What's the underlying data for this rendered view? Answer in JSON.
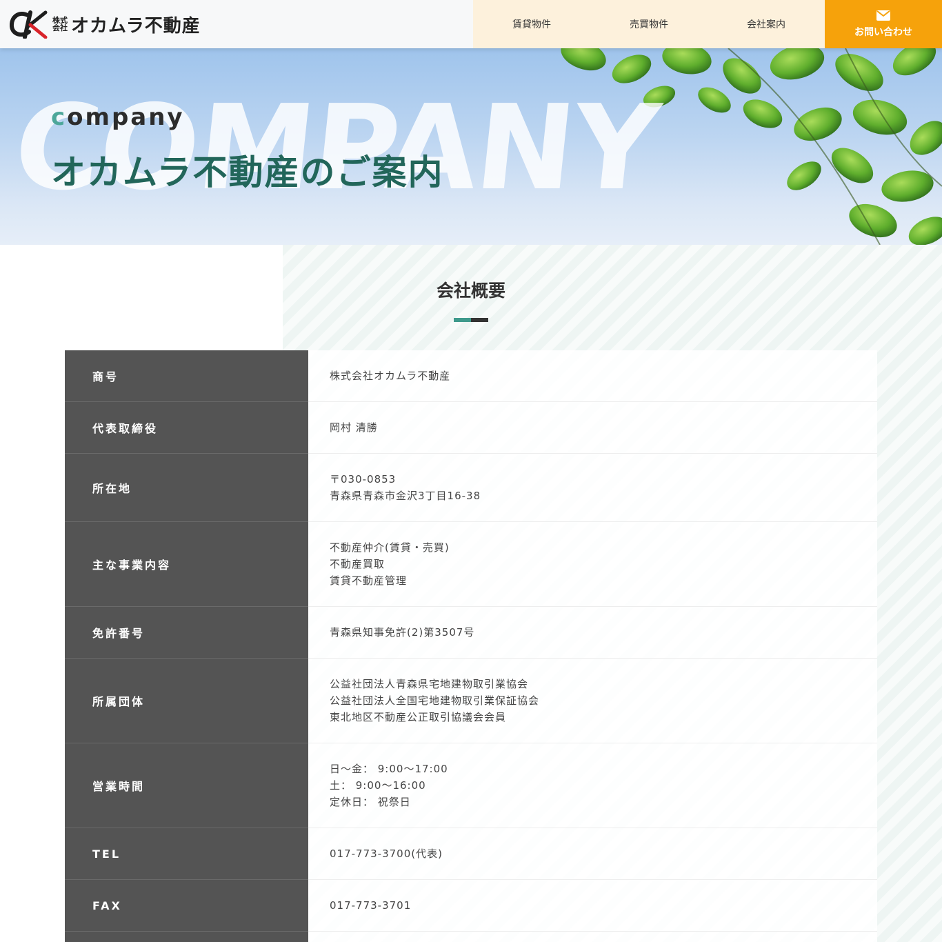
{
  "header": {
    "logo_kabu": [
      "株式",
      "会社"
    ],
    "logo_name": "オカムラ不動産",
    "nav": [
      "賃貸物件",
      "売買物件",
      "会社案内"
    ],
    "contact_label": "お問い合わせ"
  },
  "hero": {
    "watermark": "COMPANY",
    "sub_first": "c",
    "sub_rest": "ompany",
    "title": "オカムラ不動産のご案内"
  },
  "section": {
    "title": "会社概要"
  },
  "colors": {
    "accent": "#f6a20b",
    "brand_green": "#22665a",
    "nav_bg": "#fdf1dc",
    "table_head": "#545454"
  },
  "company_table": [
    {
      "label": "商号",
      "lines": [
        "株式会社オカムラ不動産"
      ]
    },
    {
      "label": "代表取締役",
      "lines": [
        "岡村 清勝"
      ]
    },
    {
      "label": "所在地",
      "lines": [
        "〒030-0853",
        "青森県青森市金沢3丁目16-38"
      ]
    },
    {
      "label": "主な事業内容",
      "lines": [
        "不動産仲介(賃貸・売買)",
        "不動産買取",
        "賃貸不動産管理"
      ]
    },
    {
      "label": "免許番号",
      "lines": [
        "青森県知事免許(2)第3507号"
      ]
    },
    {
      "label": "所属団体",
      "lines": [
        "公益社団法人青森県宅地建物取引業協会",
        "公益社団法人全国宅地建物取引業保証協会",
        "東北地区不動産公正取引協議会会員"
      ]
    },
    {
      "label": "営業時間",
      "lines": [
        "日～金： 9:00～17:00",
        "土： 9:00～16:00",
        "定休日： 祝祭日"
      ]
    },
    {
      "label": "TEL",
      "lines": [
        "017-773-3700(代表)"
      ]
    },
    {
      "label": "FAX",
      "lines": [
        "017-773-3701"
      ]
    },
    {
      "label": "",
      "lines": [
        ""
      ]
    }
  ]
}
